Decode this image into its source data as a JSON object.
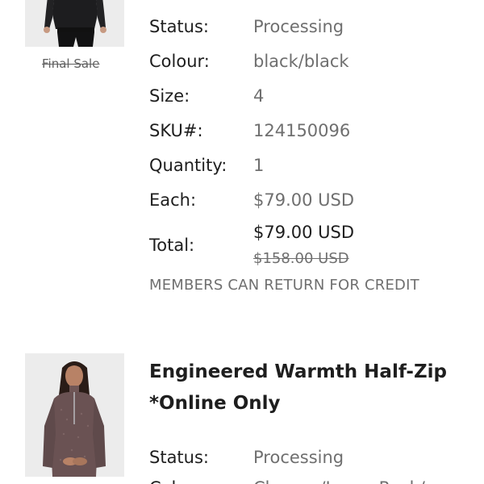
{
  "item_one": {
    "final_sale_label": "Final Sale",
    "details": [
      {
        "label": "Status:",
        "value": "Processing"
      },
      {
        "label": "Colour:",
        "value": "black/black"
      },
      {
        "label": "Size:",
        "value": "4"
      },
      {
        "label": "SKU#:",
        "value": "124150096"
      },
      {
        "label": "Quantity:",
        "value": "1"
      },
      {
        "label": "Each:",
        "value": "$79.00 USD"
      }
    ],
    "total": {
      "label": "Total:",
      "price": "$79.00 USD",
      "original_price": "$158.00 USD"
    },
    "return_policy": "MEMBERS CAN RETURN FOR CREDIT"
  },
  "item_two": {
    "title": "Engineered Warmth Half-Zip *Online Only",
    "details": [
      {
        "label": "Status:",
        "value": "Processing"
      },
      {
        "label": "Colour:",
        "value": "Chrome/Lunar Rock/"
      }
    ]
  },
  "colors": {
    "text_primary": "#1e1e1e",
    "text_secondary": "#6f6f6f",
    "thumbnail_bg": "#ebebeb"
  }
}
